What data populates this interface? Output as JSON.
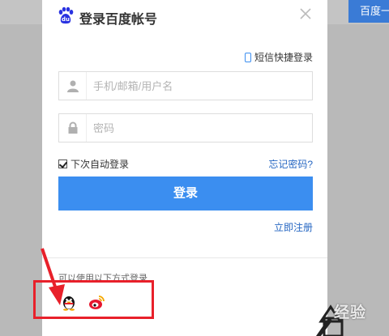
{
  "background": {
    "top_button_label": "百度一"
  },
  "dialog": {
    "title": "登录百度帐号",
    "sms_login": "短信快捷登录",
    "username_placeholder": "手机/邮箱/用户名",
    "password_placeholder": "密码",
    "remember_me": "下次自动登录",
    "remember_checked": true,
    "forgot_password": "忘记密码?",
    "login_button": "登录",
    "register": "立即注册",
    "other_login": "可以使用以下方式登录"
  },
  "watermark": {
    "text": "经验"
  },
  "colors": {
    "accent": "#3b8ef0",
    "link": "#2566c2",
    "highlight": "#e8202a"
  }
}
